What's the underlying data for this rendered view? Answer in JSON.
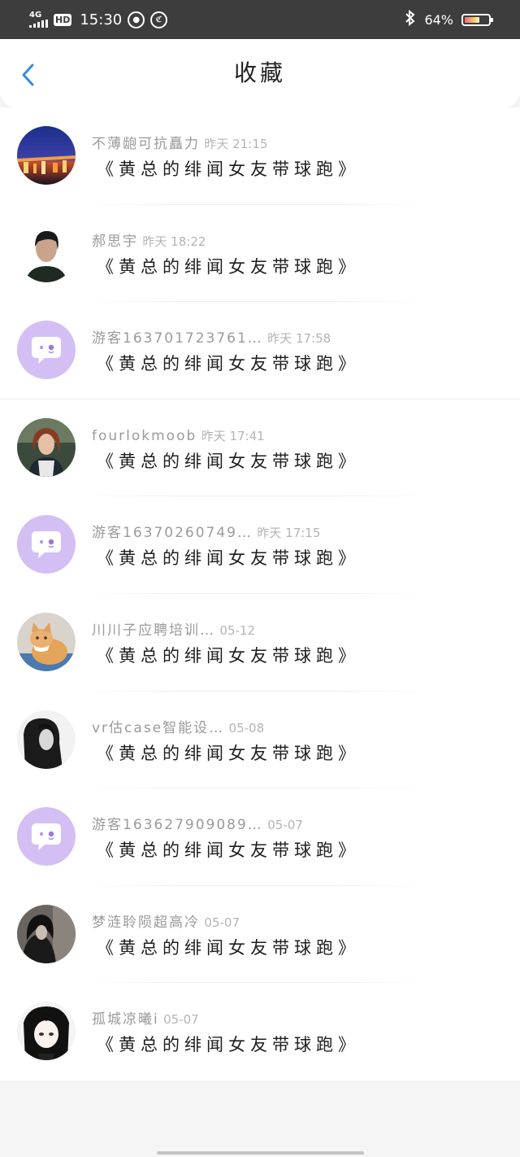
{
  "status_bar": {
    "network": "4G",
    "hd": "HD",
    "time": "15:30",
    "nfc_icon": "speed-icon",
    "badge_icon": "shield-icon",
    "battery_text": "64%",
    "battery_level": 0.64
  },
  "header": {
    "title": "收藏",
    "back_icon": "chevron-left-icon"
  },
  "favorites": [
    {
      "name": "不薄龅可抗矗力",
      "time": "昨天 21:15",
      "message": "《黄总的绯闻女友带球跑》",
      "avatar": "city-night-photo"
    },
    {
      "name": "郝思宇",
      "time": "昨天 18:22",
      "message": "《黄总的绯闻女友带球跑》",
      "avatar": "person-photo"
    },
    {
      "name": "游客163701723761…",
      "time": "昨天 17:58",
      "message": "《黄总的绯闻女友带球跑》",
      "avatar": "default-chat-avatar"
    },
    {
      "name": "fourlokmoob",
      "time": "昨天 17:41",
      "message": "《黄总的绯闻女友带球跑》",
      "avatar": "woman-photo"
    },
    {
      "name": "游客16370260749…",
      "time": "昨天 17:15",
      "message": "《黄总的绯闻女友带球跑》",
      "avatar": "default-chat-avatar"
    },
    {
      "name": "川川子应聘培训…",
      "time": "05-12",
      "message": "《黄总的绯闻女友带球跑》",
      "avatar": "cat-photo"
    },
    {
      "name": "vr估case智能设…",
      "time": "05-08",
      "message": "《黄总的绯闻女友带球跑》",
      "avatar": "bw-girl-photo"
    },
    {
      "name": "游客163627909089…",
      "time": "05-07",
      "message": "《黄总的绯闻女友带球跑》",
      "avatar": "default-chat-avatar"
    },
    {
      "name": "梦涟聆陨超高冷",
      "time": "05-07",
      "message": "《黄总的绯闻女友带球跑》",
      "avatar": "dark-girl-photo"
    },
    {
      "name": "孤城凉曦i",
      "time": "05-07",
      "message": "《黄总的绯闻女友带球跑》",
      "avatar": "anime-girl-avatar"
    }
  ],
  "colors": {
    "accent": "#2f8ee0",
    "default_avatar_bg": "#d4bff5",
    "status_bar_bg": "#3d3d3d"
  }
}
